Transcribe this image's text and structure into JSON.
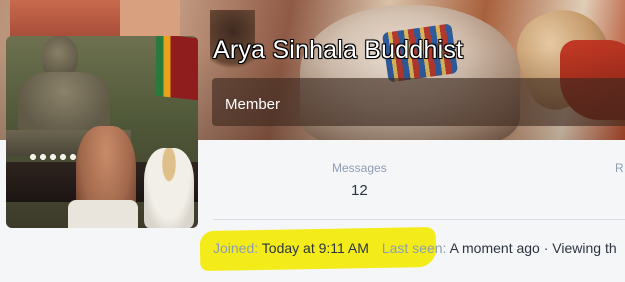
{
  "profile": {
    "username": "Arya Sinhala Buddhist",
    "user_title": "Member"
  },
  "stats": [
    {
      "label": "Messages",
      "value": "12"
    },
    {
      "label": "R"
    }
  ],
  "info": {
    "joined_label": "Joined:",
    "joined_value": "Today at 9:11 AM",
    "last_seen_label": "Last seen:",
    "last_seen_value": "A moment ago · Viewing th"
  },
  "annotations": {
    "highlight_color": "#f4ec1a"
  },
  "icons": [
    "avatar-image",
    "cover-image"
  ]
}
